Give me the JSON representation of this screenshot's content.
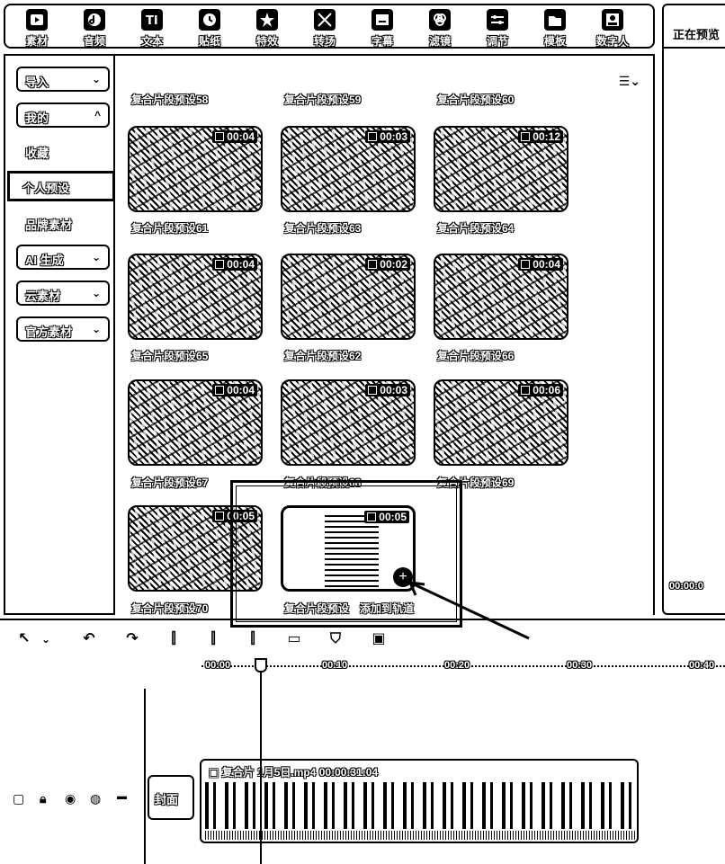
{
  "toolbar": {
    "items": [
      {
        "label": "素材",
        "icon": "media-icon"
      },
      {
        "label": "音频",
        "icon": "music-note-icon"
      },
      {
        "label": "文本",
        "icon": "text-icon"
      },
      {
        "label": "贴纸",
        "icon": "clock-sticker-icon"
      },
      {
        "label": "特效",
        "icon": "sparkle-icon"
      },
      {
        "label": "转场",
        "icon": "transition-icon"
      },
      {
        "label": "字幕",
        "icon": "subtitle-icon"
      },
      {
        "label": "滤镜",
        "icon": "filter-icon"
      },
      {
        "label": "调节",
        "icon": "adjust-icon"
      },
      {
        "label": "模板",
        "icon": "template-icon"
      },
      {
        "label": "数字人",
        "icon": "avatar-icon"
      }
    ]
  },
  "right_panel": {
    "title": "正在预览",
    "time": "00:00:0"
  },
  "sidebar": {
    "import": "导入",
    "mine": "我的",
    "favorites": "收藏",
    "personal_presets": "个人预设",
    "brand_assets": "品牌素材",
    "ai_generate": "AI 生成",
    "cloud_assets": "云素材",
    "official_assets": "官方素材"
  },
  "media": {
    "top_captions": [
      "复合片段预设58",
      "复合片段预设59",
      "复合片段预设60"
    ],
    "cards": [
      {
        "duration": "00:04",
        "caption": "复合片段预设61"
      },
      {
        "duration": "00:03",
        "caption": "复合片段预设63"
      },
      {
        "duration": "00:12",
        "caption": "复合片段预设64"
      },
      {
        "duration": "00:04",
        "caption": "复合片段预设65"
      },
      {
        "duration": "00:02",
        "caption": "复合片段预设62"
      },
      {
        "duration": "00:04",
        "caption": "复合片段预设66"
      },
      {
        "duration": "00:04",
        "caption": "复合片段预设67"
      },
      {
        "duration": "00:03",
        "caption": "复合片段预设68"
      },
      {
        "duration": "00:06",
        "caption": "复合片段预设69"
      },
      {
        "duration": "00:05",
        "caption": "复合片段预设70"
      },
      {
        "duration": "00:05",
        "caption": "复合片段预设"
      }
    ],
    "add_to_track": "添加到轨道"
  },
  "timeline": {
    "ruler": [
      "00:00",
      "00:10",
      "00:20",
      "00:30",
      "00:40"
    ],
    "cover_label": "封面",
    "clip_title": "复合片",
    "clip_name": "1月5日.mp4",
    "clip_duration": "00:00:31:04"
  }
}
